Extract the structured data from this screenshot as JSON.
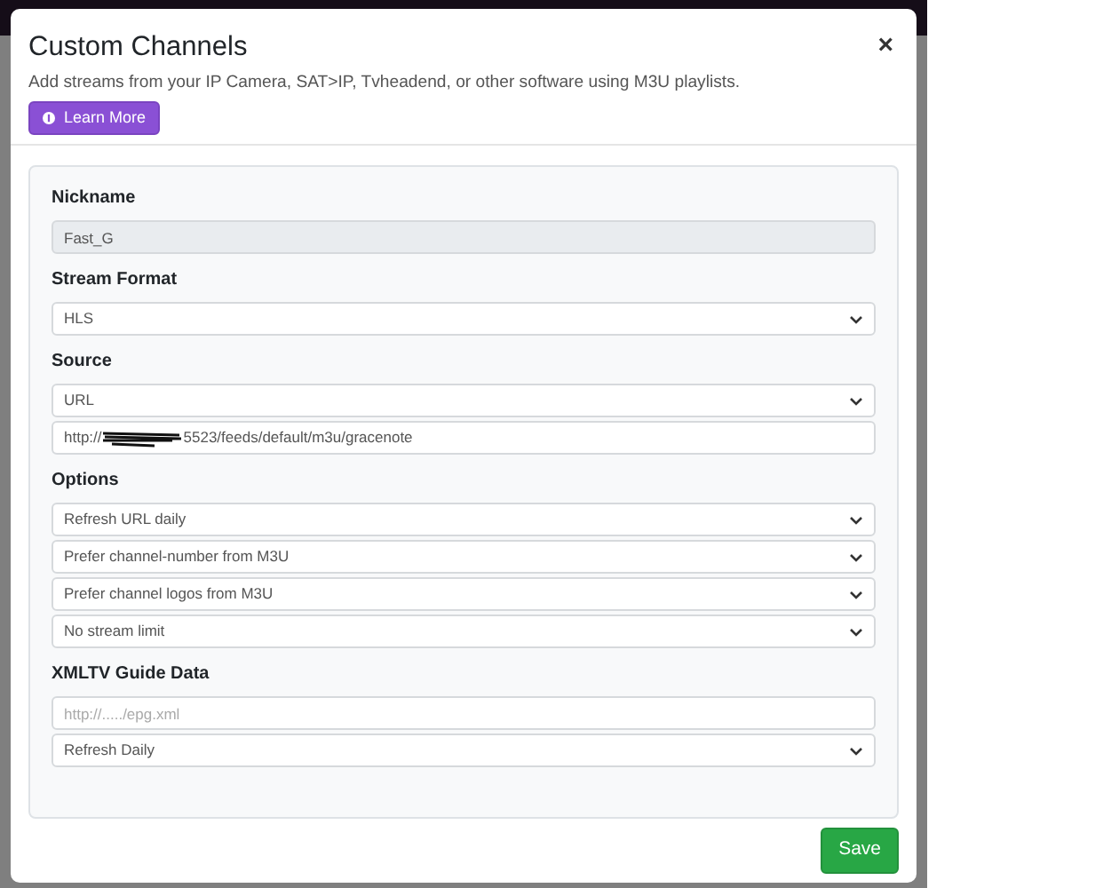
{
  "dialog": {
    "title": "Custom Channels",
    "close": "×",
    "subtitle": "Add streams from your IP Camera, SAT>IP, Tvheadend, or other software using M3U playlists.",
    "learn_more_button": "Learn More"
  },
  "sections": [
    {
      "label": "Nickname",
      "fields": [
        {
          "kind": "input",
          "value": "Fast_G",
          "disabled": true
        }
      ]
    },
    {
      "label": "Stream Format",
      "fields": [
        {
          "kind": "select",
          "value": "HLS"
        }
      ]
    },
    {
      "label": "Source",
      "fields": [
        {
          "kind": "select",
          "value": "URL"
        },
        {
          "kind": "redacted_input",
          "value_start": "http://",
          "value_end": "5523/feeds/default/m3u/gracenote"
        }
      ]
    },
    {
      "label": "Options",
      "fields": [
        {
          "kind": "select",
          "value": "Refresh URL daily"
        },
        {
          "kind": "select",
          "value": "Prefer channel-number from M3U"
        },
        {
          "kind": "select",
          "value": "Prefer channel logos from M3U"
        },
        {
          "kind": "select",
          "value": "No stream limit"
        }
      ]
    },
    {
      "label": "XMLTV Guide Data",
      "fields": [
        {
          "kind": "input",
          "placeholder": "http://...../epg.xml",
          "disabled": false
        },
        {
          "kind": "select",
          "value": "Refresh Daily"
        }
      ]
    }
  ],
  "save_button": "Save"
}
